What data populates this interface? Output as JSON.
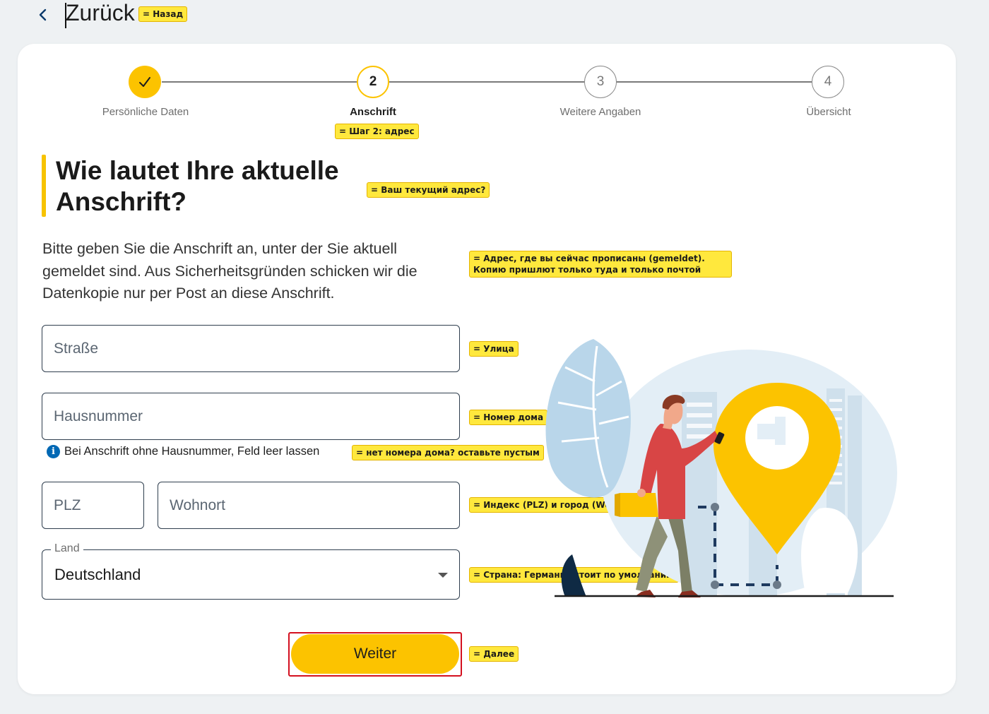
{
  "nav": {
    "back_label": "Zurück",
    "back_annotation": "= Назад"
  },
  "stepper": {
    "steps": [
      {
        "number": "✓",
        "label": "Persönliche Daten",
        "state": "done"
      },
      {
        "number": "2",
        "label": "Anschrift",
        "state": "active"
      },
      {
        "number": "3",
        "label": "Weitere Angaben",
        "state": "pending"
      },
      {
        "number": "4",
        "label": "Übersicht",
        "state": "pending"
      }
    ],
    "active_annotation": "= Шаг 2: адрес"
  },
  "form": {
    "title": "Wie lautet Ihre aktuelle Anschrift?",
    "title_annotation": "= Ваш текущий адрес?",
    "intro": "Bitte geben Sie die Anschrift an, unter der Sie aktuell gemeldet sind. Aus Sicherheitsgründen schicken wir die Datenkopie nur per Post an diese Anschrift.",
    "intro_annotation": "= Адрес, где вы сейчас прописаны (gemeldet). Копию пришлют только туда и только почтой",
    "street": {
      "placeholder": "Straße",
      "annotation": "= Улица"
    },
    "house_number": {
      "placeholder": "Hausnummer",
      "annotation": "= Номер дома"
    },
    "hint": {
      "text": "Bei Anschrift ohne Hausnummer, Feld leer lassen",
      "annotation": "= нет номера дома? оставьте пустым"
    },
    "zip": {
      "placeholder": "PLZ"
    },
    "city": {
      "placeholder": "Wohnort",
      "annotation": "= Индекс (PLZ) и город (Wohnort)"
    },
    "country": {
      "label": "Land",
      "value": "Deutschland",
      "annotation": "= Страна: Германия стоит по умолчанию"
    },
    "submit": {
      "label": "Weiter",
      "annotation": "= Далее"
    }
  },
  "colors": {
    "accent": "#fcc300",
    "highlight_outline": "#d4101f",
    "annotation_bg": "#ffe83d",
    "info_blue": "#0068b4"
  }
}
